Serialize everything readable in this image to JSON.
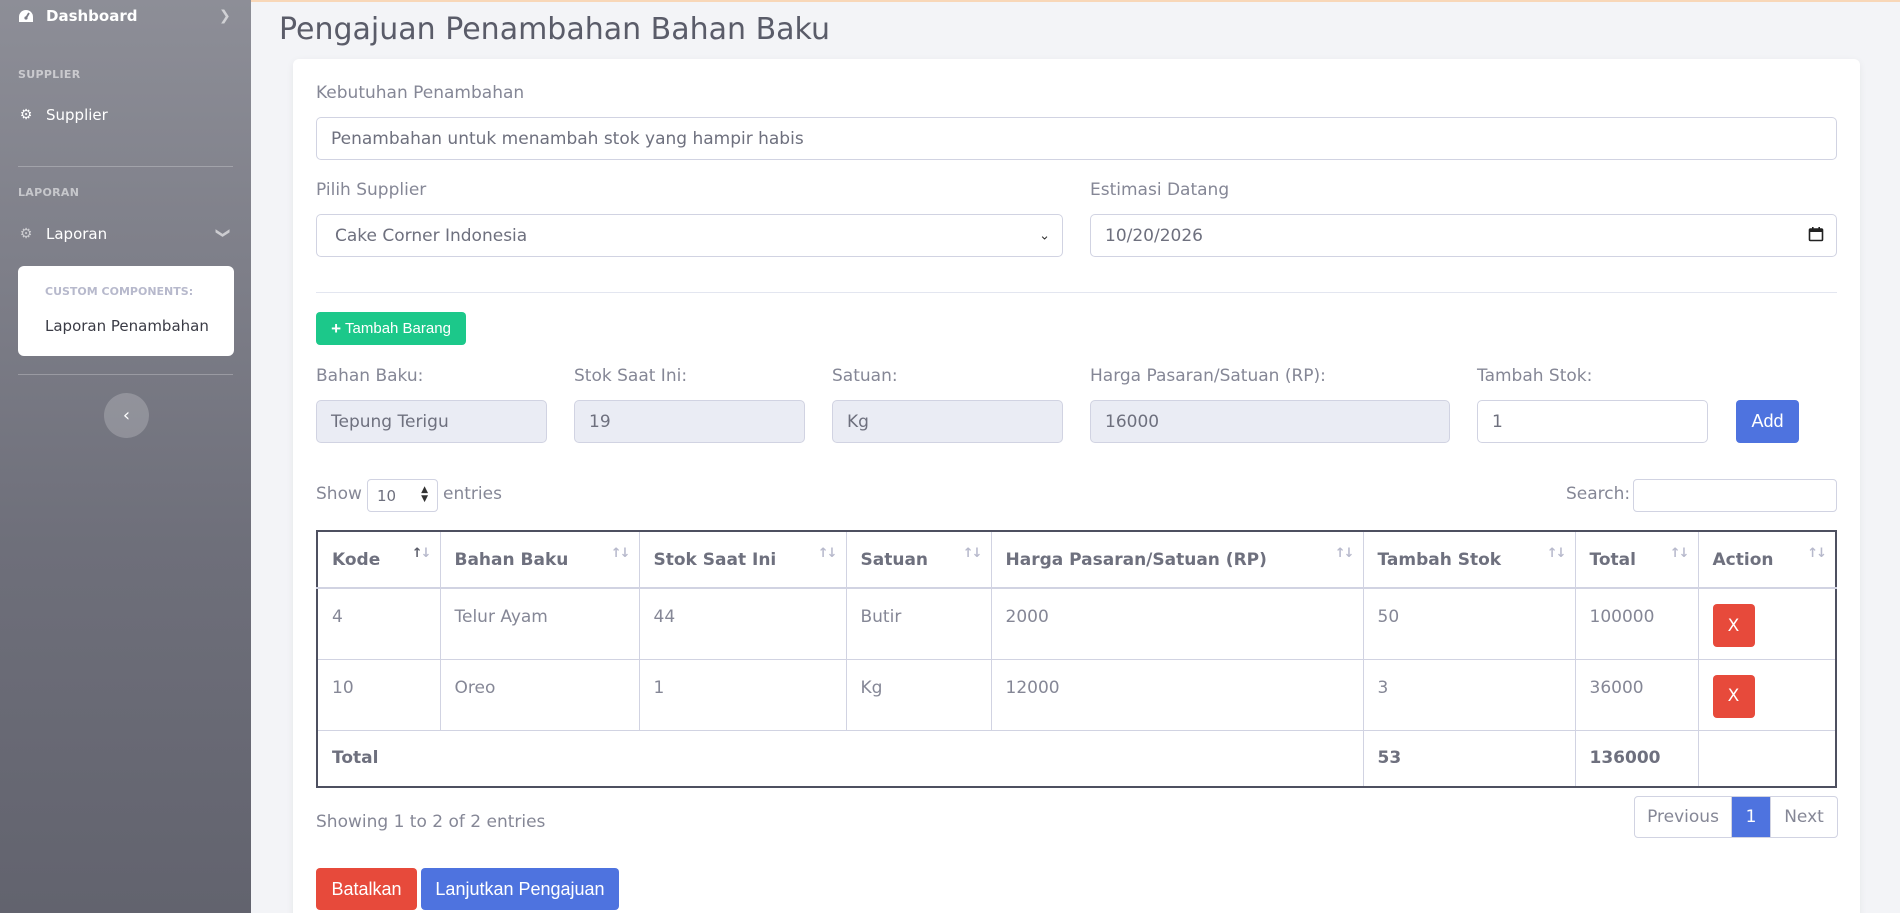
{
  "sidebar": {
    "dashboard_label": "Dashboard",
    "heading_supplier": "SUPPLIER",
    "supplier_label": "Supplier",
    "heading_laporan": "LAPORAN",
    "laporan_label": "Laporan",
    "submenu_heading": "CUSTOM COMPONENTS:",
    "submenu_item": "Laporan Penambahan"
  },
  "page": {
    "title": "Pengajuan Penambahan Bahan Baku"
  },
  "form": {
    "kebutuhan_label": "Kebutuhan Penambahan",
    "kebutuhan_value": "Penambahan untuk menambah stok yang hampir habis",
    "supplier_label": "Pilih Supplier",
    "supplier_value": "Cake Corner Indonesia",
    "estimasi_label": "Estimasi Datang",
    "estimasi_value": "10/20/2026",
    "tambah_barang_label": "Tambah Barang",
    "bahan_label": "Bahan Baku:",
    "bahan_value": "Tepung Terigu",
    "stok_label": "Stok Saat Ini:",
    "stok_value": "19",
    "satuan_label": "Satuan:",
    "satuan_value": "Kg",
    "harga_label": "Harga Pasaran/Satuan (RP):",
    "harga_value": "16000",
    "tambah_stok_label": "Tambah Stok:",
    "tambah_stok_value": "1",
    "add_label": "Add"
  },
  "datatable": {
    "show_label": "Show",
    "show_value": "10",
    "entries_label": "entries",
    "search_label": "Search:",
    "search_value": "",
    "columns": [
      "Kode",
      "Bahan Baku",
      "Stok Saat Ini",
      "Satuan",
      "Harga Pasaran/Satuan (RP)",
      "Tambah Stok",
      "Total",
      "Action"
    ],
    "rows": [
      {
        "kode": "4",
        "bahan": "Telur Ayam",
        "stok": "44",
        "satuan": "Butir",
        "harga": "2000",
        "tambah": "50",
        "total": "100000",
        "action": "X"
      },
      {
        "kode": "10",
        "bahan": "Oreo",
        "stok": "1",
        "satuan": "Kg",
        "harga": "12000",
        "tambah": "3",
        "total": "36000",
        "action": "X"
      }
    ],
    "footer": {
      "label": "Total",
      "tambah": "53",
      "total": "136000"
    },
    "info": "Showing 1 to 2 of 2 entries",
    "pager": {
      "previous": "Previous",
      "page": "1",
      "next": "Next"
    }
  },
  "actions": {
    "batalkan": "Batalkan",
    "lanjutkan": "Lanjutkan Pengajuan"
  }
}
